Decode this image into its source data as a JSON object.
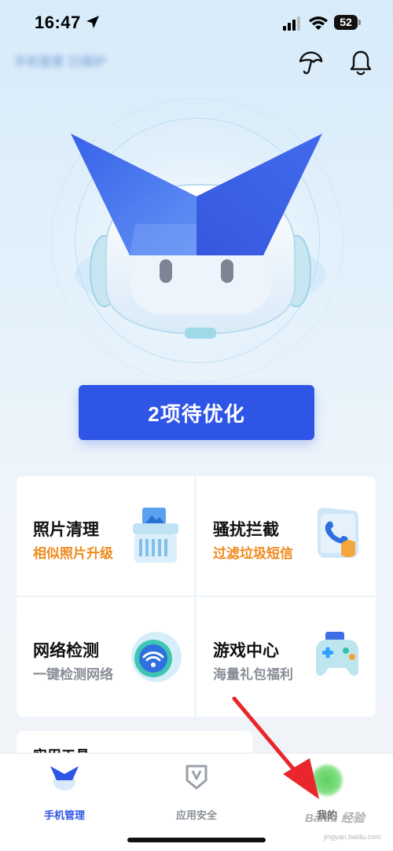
{
  "status_bar": {
    "time": "16:47",
    "battery": "52"
  },
  "header": {
    "title_blurred": "手机管家 已保护"
  },
  "main": {
    "optimize_button": "2项待优化"
  },
  "cards": [
    {
      "title": "照片清理",
      "subtitle": "相似照片升级",
      "icon": "shredder-photo-icon"
    },
    {
      "title": "骚扰拦截",
      "subtitle": "过滤垃圾短信",
      "icon": "phone-shield-icon"
    },
    {
      "title": "网络检测",
      "subtitle": "一键检测网络",
      "icon": "wifi-globe-icon"
    },
    {
      "title": "游戏中心",
      "subtitle": "海量礼包福利",
      "icon": "gamepad-icon"
    }
  ],
  "tools_section": {
    "title": "实用工具"
  },
  "tabbar": {
    "tabs": [
      {
        "label": "手机管理",
        "active": true
      },
      {
        "label": "应用安全",
        "active": false
      },
      {
        "label": "我的",
        "active": false
      }
    ]
  },
  "watermark": {
    "brand": "Baidu 经验",
    "url": "jingyan.baidu.com"
  },
  "colors": {
    "accent": "#2f55e6",
    "orange": "#f08a1c",
    "arrow": "#e8262b"
  }
}
